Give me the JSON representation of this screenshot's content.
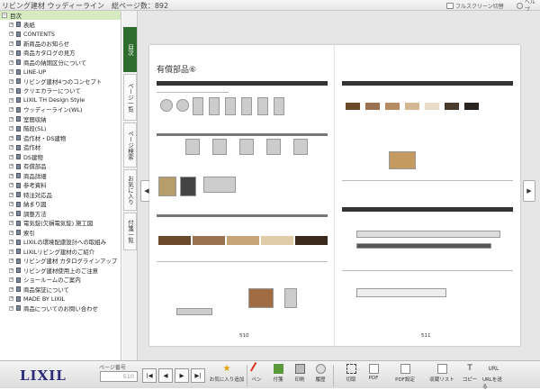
{
  "titlebar": {
    "title": "リビング建材 ウッディーライン　総ページ数：892",
    "fullscreen": "フルスクリーン切替",
    "help": "ヘルプ"
  },
  "sidebar": {
    "root_label": "目次",
    "items": [
      "表紙",
      "CONTENTS",
      "新商品のお知らせ",
      "商品カタログの見方",
      "商品の納期区分について",
      "LINE-UP",
      "リビング建材4つのコンセプト",
      "クリエカラーについて",
      "LIXIL TH Design Style",
      "ウッディーライン(WL)",
      "室間収納",
      "階段(SL)",
      "造作材・DS建物",
      "造作材",
      "DS建物",
      "有償部品",
      "商品詳細",
      "参考資料",
      "特注対応品",
      "納まり図",
      "調整方法",
      "電気錠(欠損電気錠)  施工図",
      "索引",
      "LIXILの環境配慮設計への取組み",
      "LIXILリビング建材のご紹介",
      "リビング建材 カタログラインアップ",
      "リビング建材使用上のご注意",
      "ショールームのご案内",
      "商品保証について",
      "MADE BY LIXIL",
      "商品についてのお問い合わせ"
    ]
  },
  "vtabs": [
    "目次",
    "ページ一覧",
    "ページ検索",
    "お気に入り",
    "付箋一覧"
  ],
  "viewer": {
    "left_page": {
      "title": "有償部品⑥",
      "number": "510"
    },
    "right_page": {
      "number": "511"
    }
  },
  "bottombar": {
    "logo": "LIXIL",
    "page_no_label": "ページ番号",
    "page_input_value": "510",
    "nav": [
      "|◀",
      "◀",
      "▶",
      "▶|"
    ],
    "tools": [
      "お気に入り追加",
      "ペン",
      "付箋",
      "印刷",
      "履歴",
      "切取",
      "PDF",
      "PDF設定",
      "収蔵リスト",
      "コピー",
      "URLを送る"
    ]
  },
  "colors": {
    "accent_green": "#2f6d2f",
    "logo_navy": "#2c2c7a",
    "tree_highlight": "#d6ecc0"
  }
}
